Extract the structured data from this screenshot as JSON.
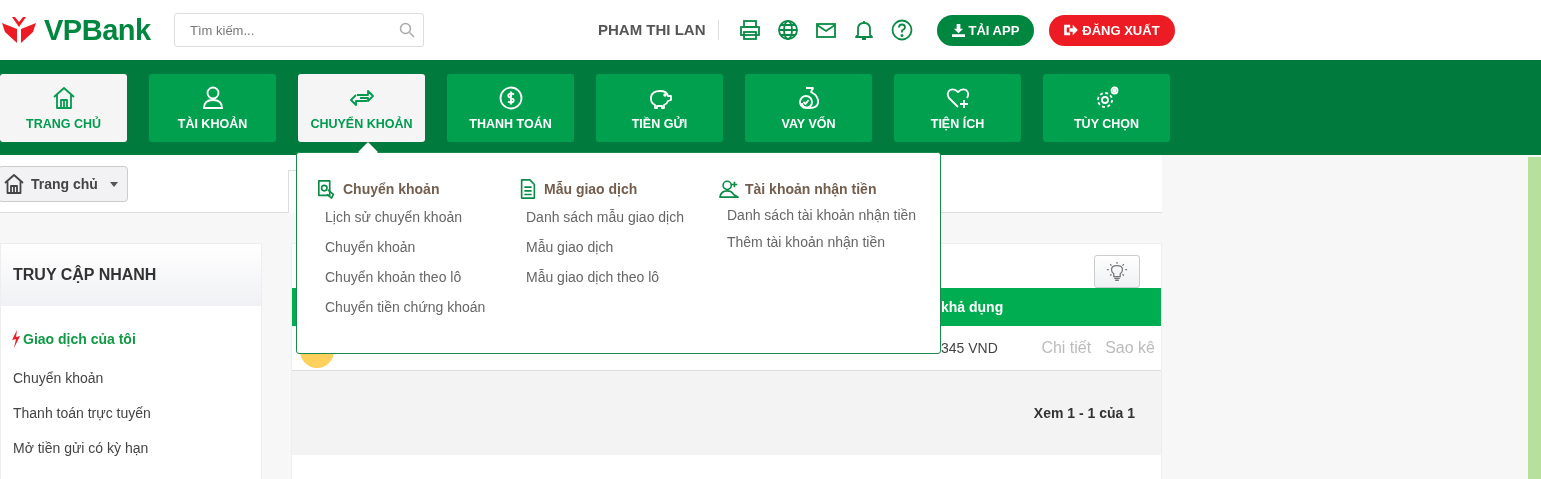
{
  "header": {
    "logo": "VPBank",
    "search": {
      "placeholder": "Tìm kiếm..."
    },
    "user_name": "PHAM THI LAN",
    "buttons": [
      {
        "label": "TẢI APP",
        "kind": "download"
      },
      {
        "label": "ĐĂNG XUẤT",
        "kind": "logout"
      }
    ]
  },
  "nav": [
    {
      "label": "TRANG CHỦ",
      "kind": "home",
      "selected": true
    },
    {
      "label": "TÀI KHOẢN",
      "kind": "account",
      "selected": false
    },
    {
      "label": "CHUYỂN KHOẢN",
      "kind": "transfer",
      "selected": true
    },
    {
      "label": "THANH TOÁN",
      "kind": "payment",
      "selected": false
    },
    {
      "label": "TIỀN GỬI",
      "kind": "savings",
      "selected": false
    },
    {
      "label": "VAY VỐN",
      "kind": "loan",
      "selected": false
    },
    {
      "label": "TIỆN ÍCH",
      "kind": "utility",
      "selected": false
    },
    {
      "label": "TÙY CHỌN",
      "kind": "settings",
      "selected": false
    }
  ],
  "menu": {
    "columns": [
      {
        "title": "Chuyển khoản",
        "kind": "transfer",
        "items": [
          "Lịch sử chuyển khoản",
          "Chuyển khoản",
          "Chuyển khoản theo lô",
          "Chuyển tiền chứng khoán"
        ]
      },
      {
        "title": "Mẫu giao dịch",
        "kind": "template",
        "items": [
          "Danh sách mẫu giao dịch",
          "Mẫu giao dịch",
          "Mẫu giao dịch theo lô"
        ]
      },
      {
        "title": "Tài khoản nhận tiền",
        "kind": "payee",
        "items": [
          "Danh sách tài khoản nhận tiền",
          "Thêm tài khoản nhận tiền"
        ]
      }
    ]
  },
  "breadcrumb": {
    "label": "Trang chủ"
  },
  "sidebar": {
    "title": "TRUY CẬP NHANH",
    "section": "Giao dịch của tôi",
    "items": [
      "Chuyển khoản",
      "Thanh toán trực tuyến",
      "Mở tiền gửi có kỳ hạn"
    ]
  },
  "table": {
    "header": "khả dụng",
    "rows": [
      {
        "balance": "345 VND",
        "actions": [
          "Chi tiết",
          "Sao kê"
        ]
      }
    ],
    "footer": "Xem 1 - 1 của 1"
  }
}
